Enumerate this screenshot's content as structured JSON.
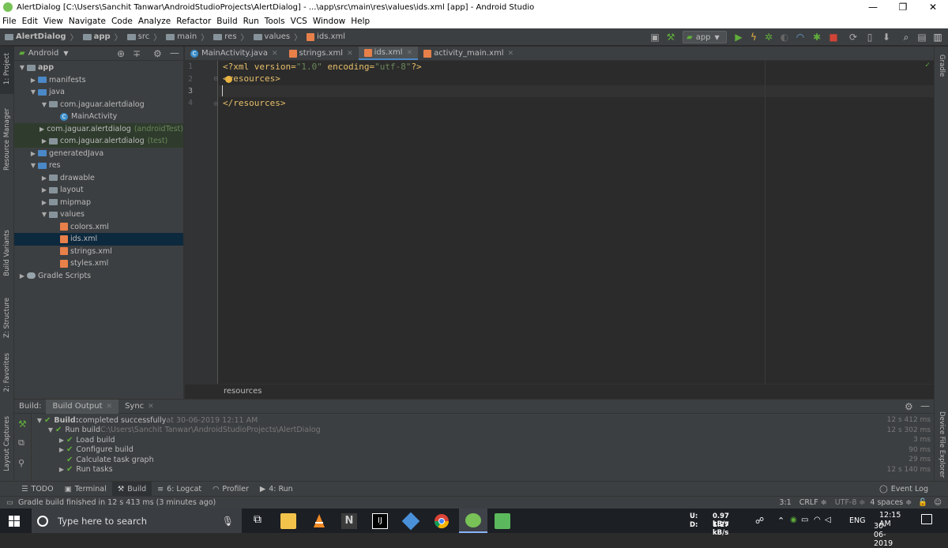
{
  "window": {
    "title": "AlertDialog [C:\\Users\\Sanchit Tanwar\\AndroidStudioProjects\\AlertDialog] - ...\\app\\src\\main\\res\\values\\ids.xml [app] - Android Studio",
    "minimize": "—",
    "maximize": "❐",
    "close": "✕"
  },
  "menu": [
    "File",
    "Edit",
    "View",
    "Navigate",
    "Code",
    "Analyze",
    "Refactor",
    "Build",
    "Run",
    "Tools",
    "VCS",
    "Window",
    "Help"
  ],
  "breadcrumb": [
    "AlertDialog",
    "app",
    "src",
    "main",
    "res",
    "values",
    "ids.xml"
  ],
  "toolbar": {
    "run_config": "app"
  },
  "project_panel": {
    "view_mode": "Android",
    "tree": [
      {
        "label": "app",
        "extra": "",
        "depth": 0,
        "arrow": "▼",
        "icon": "folder"
      },
      {
        "label": "manifests",
        "extra": "",
        "depth": 1,
        "arrow": "▶",
        "icon": "folder-blue"
      },
      {
        "label": "java",
        "extra": "",
        "depth": 1,
        "arrow": "▼",
        "icon": "folder-blue"
      },
      {
        "label": "com.jaguar.alertdialog",
        "extra": "",
        "depth": 2,
        "arrow": "▼",
        "icon": "folder"
      },
      {
        "label": "MainActivity",
        "extra": "",
        "depth": 3,
        "arrow": "",
        "icon": "class"
      },
      {
        "label": "com.jaguar.alertdialog",
        "extra": "(androidTest)",
        "depth": 2,
        "arrow": "▶",
        "icon": "folder"
      },
      {
        "label": "com.jaguar.alertdialog",
        "extra": "(test)",
        "depth": 2,
        "arrow": "▶",
        "icon": "folder"
      },
      {
        "label": "generatedJava",
        "extra": "",
        "depth": 1,
        "arrow": "▶",
        "icon": "folder-blue"
      },
      {
        "label": "res",
        "extra": "",
        "depth": 1,
        "arrow": "▼",
        "icon": "folder-blue"
      },
      {
        "label": "drawable",
        "extra": "",
        "depth": 2,
        "arrow": "▶",
        "icon": "folder"
      },
      {
        "label": "layout",
        "extra": "",
        "depth": 2,
        "arrow": "▶",
        "icon": "folder"
      },
      {
        "label": "mipmap",
        "extra": "",
        "depth": 2,
        "arrow": "▶",
        "icon": "folder"
      },
      {
        "label": "values",
        "extra": "",
        "depth": 2,
        "arrow": "▼",
        "icon": "folder"
      },
      {
        "label": "colors.xml",
        "extra": "",
        "depth": 3,
        "arrow": "",
        "icon": "xml"
      },
      {
        "label": "ids.xml",
        "extra": "",
        "depth": 3,
        "arrow": "",
        "icon": "xml"
      },
      {
        "label": "strings.xml",
        "extra": "",
        "depth": 3,
        "arrow": "",
        "icon": "xml"
      },
      {
        "label": "styles.xml",
        "extra": "",
        "depth": 3,
        "arrow": "",
        "icon": "xml"
      },
      {
        "label": "Gradle Scripts",
        "extra": "",
        "depth": 0,
        "arrow": "▶",
        "icon": "gradle"
      }
    ]
  },
  "side_tabs_left": [
    "1: Project",
    "Resource Manager",
    "Build Variants",
    "Z: Structure",
    "2: Favorites",
    "Layout Captures"
  ],
  "side_tabs_right": [
    "Gradle",
    "Device File Explorer"
  ],
  "editor_tabs": [
    {
      "label": "MainActivity.java",
      "active": false
    },
    {
      "label": "strings.xml",
      "active": false
    },
    {
      "label": "ids.xml",
      "active": true
    },
    {
      "label": "activity_main.xml",
      "active": false
    }
  ],
  "editor": {
    "line_numbers": [
      "1",
      "2",
      "3",
      "4"
    ],
    "line1": {
      "a": "<?xml version=",
      "b": "\"1.0\"",
      "c": " encoding=",
      "d": "\"utf-8\"",
      "e": "?>"
    },
    "line2": "<resources>",
    "line4": "</resources>",
    "breadcrumb": "resources"
  },
  "build_panel": {
    "label": "Build:",
    "tabs": [
      "Build Output",
      "Sync"
    ],
    "rows": [
      {
        "text": "Build:",
        "rest": " completed successfully",
        "detail": " at 30-06-2019 12:11 AM",
        "time": "12 s 412 ms"
      },
      {
        "text": "Run build",
        "rest": "",
        "detail": " C:\\Users\\Sanchit Tanwar\\AndroidStudioProjects\\AlertDialog",
        "time": "12 s 302 ms"
      },
      {
        "text": "Load build",
        "rest": "",
        "detail": "",
        "time": "3 ms"
      },
      {
        "text": "Configure build",
        "rest": "",
        "detail": "",
        "time": "90 ms"
      },
      {
        "text": "Calculate task graph",
        "rest": "",
        "detail": "",
        "time": "29 ms"
      },
      {
        "text": "Run tasks",
        "rest": "",
        "detail": "",
        "time": "12 s 140 ms"
      }
    ]
  },
  "bottom_tools": [
    "TODO",
    "Terminal",
    "Build",
    "6: Logcat",
    "Profiler",
    "4: Run"
  ],
  "event_log": "Event Log",
  "status": {
    "message": "Gradle build finished in 12 s 413 ms (3 minutes ago)",
    "position": "3:1",
    "line_sep": "CRLF ≑",
    "encoding": "UTF-8 ≑",
    "indent": "4 spaces ≑"
  },
  "taskbar": {
    "search_placeholder": "Type here to search",
    "net_up_label": "U:",
    "net_up": "0.97 kB/s",
    "net_down_label": "D:",
    "net_down": "1.27 kB/s",
    "lang": "ENG",
    "time": "12:15 AM",
    "date": "30-06-2019"
  },
  "colors": {
    "ide_bg": "#2b2b2b",
    "panel_bg": "#3c3f41",
    "selection": "#0d293e",
    "accent_blue": "#4a88c7",
    "success_green": "#5fad3b"
  }
}
